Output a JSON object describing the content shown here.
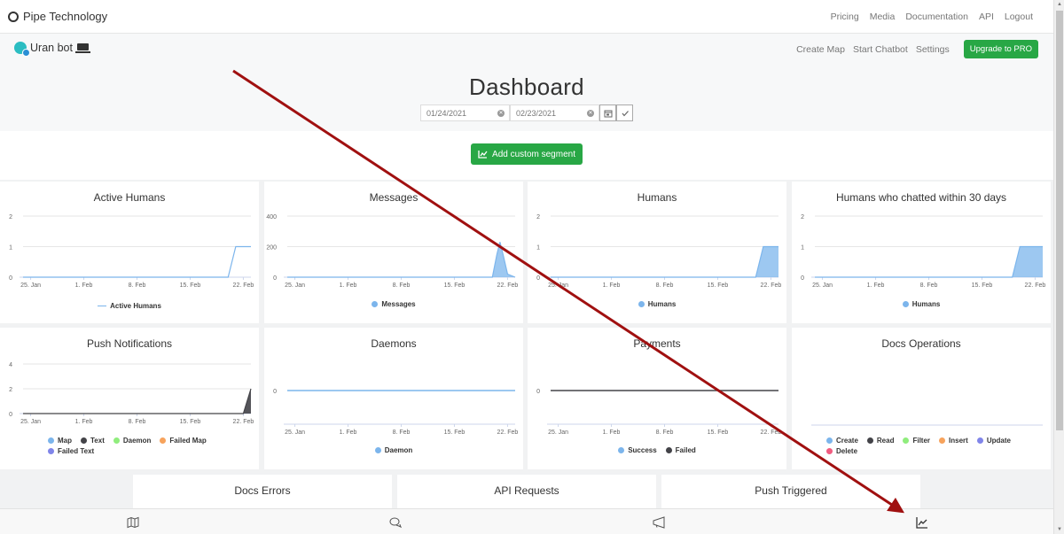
{
  "topnav": {
    "brand": "Pipe Technology",
    "links": [
      "Pricing",
      "Media",
      "Documentation",
      "API",
      "Logout"
    ]
  },
  "subheader": {
    "bot_name": "Uran bot",
    "links": [
      "Create Map",
      "Start Chatbot",
      "Settings"
    ],
    "upgrade_label": "Upgrade to PRO",
    "title": "Dashboard",
    "date_from": "01/24/2021",
    "date_to": "02/23/2021",
    "add_segment_label": "Add custom segment"
  },
  "colors": {
    "green": "#28a745",
    "series_blue": "#7cb5ec",
    "series_dark": "#434348",
    "series_green": "#90ed7d",
    "series_orange": "#f7a35c",
    "series_purple": "#8085e9",
    "series_pink": "#f15c80",
    "annotation_arrow": "#a01010"
  },
  "x_ticks": [
    "25. Jan",
    "1. Feb",
    "8. Feb",
    "15. Feb",
    "22. Feb"
  ],
  "chart_data": [
    {
      "id": "active-humans",
      "type": "line",
      "title": "Active Humans",
      "yticks": [
        "0",
        "1",
        "2"
      ],
      "ylim": [
        0,
        2
      ],
      "x": [
        "24. Jan",
        "20. Feb",
        "21. Feb",
        "23. Feb"
      ],
      "series": [
        {
          "name": "Active Humans",
          "color": "#7cb5ec",
          "style": "line",
          "points": [
            [
              0,
              0
            ],
            [
              27,
              0
            ],
            [
              28,
              1
            ],
            [
              30,
              1
            ]
          ]
        }
      ],
      "legend": [
        {
          "label": "Active Humans",
          "color": "#7cb5ec",
          "marker": "line"
        }
      ]
    },
    {
      "id": "messages",
      "type": "area",
      "title": "Messages",
      "yticks": [
        "0",
        "200",
        "400"
      ],
      "ylim": [
        0,
        400
      ],
      "series": [
        {
          "name": "Messages",
          "color": "#7cb5ec",
          "style": "area",
          "points": [
            [
              0,
              0
            ],
            [
              27,
              0
            ],
            [
              27.6,
              150
            ],
            [
              28,
              230
            ],
            [
              28.4,
              150
            ],
            [
              29,
              20
            ],
            [
              30,
              0
            ]
          ]
        }
      ],
      "legend": [
        {
          "label": "Messages",
          "color": "#7cb5ec",
          "marker": "dot"
        }
      ]
    },
    {
      "id": "humans",
      "type": "area",
      "title": "Humans",
      "yticks": [
        "0",
        "1",
        "2"
      ],
      "ylim": [
        0,
        2
      ],
      "series": [
        {
          "name": "Humans",
          "color": "#7cb5ec",
          "style": "area",
          "points": [
            [
              0,
              0
            ],
            [
              27,
              0
            ],
            [
              28,
              1
            ],
            [
              30,
              1
            ]
          ]
        }
      ],
      "legend": [
        {
          "label": "Humans",
          "color": "#7cb5ec",
          "marker": "dot"
        }
      ]
    },
    {
      "id": "humans-30d",
      "type": "area",
      "title": "Humans who chatted within 30 days",
      "yticks": [
        "0",
        "1",
        "2"
      ],
      "ylim": [
        0,
        2
      ],
      "series": [
        {
          "name": "Humans",
          "color": "#7cb5ec",
          "style": "area",
          "points": [
            [
              0,
              0
            ],
            [
              26,
              0
            ],
            [
              27,
              1
            ],
            [
              30,
              1
            ]
          ]
        }
      ],
      "legend": [
        {
          "label": "Humans",
          "color": "#7cb5ec",
          "marker": "dot"
        }
      ]
    },
    {
      "id": "push-notifications",
      "type": "area",
      "title": "Push Notifications",
      "yticks": [
        "0",
        "2",
        "4"
      ],
      "ylim": [
        0,
        4
      ],
      "series": [
        {
          "name": "Text",
          "color": "#434348",
          "style": "area",
          "points": [
            [
              0,
              0
            ],
            [
              29,
              0
            ],
            [
              30,
              2
            ]
          ]
        }
      ],
      "legend": [
        {
          "label": "Map",
          "color": "#7cb5ec",
          "marker": "dot"
        },
        {
          "label": "Text",
          "color": "#434348",
          "marker": "dot"
        },
        {
          "label": "Daemon",
          "color": "#90ed7d",
          "marker": "dot"
        },
        {
          "label": "Failed Map",
          "color": "#f7a35c",
          "marker": "dot"
        },
        {
          "label": "Failed Text",
          "color": "#8085e9",
          "marker": "dot"
        }
      ]
    },
    {
      "id": "daemons",
      "type": "line",
      "title": "Daemons",
      "yticks": [
        "0"
      ],
      "ylim": [
        -1,
        1
      ],
      "center_zero": true,
      "series": [
        {
          "name": "Daemon",
          "color": "#7cb5ec",
          "style": "line",
          "points": [
            [
              0,
              0
            ],
            [
              30,
              0
            ]
          ]
        }
      ],
      "legend": [
        {
          "label": "Daemon",
          "color": "#7cb5ec",
          "marker": "dot"
        }
      ]
    },
    {
      "id": "payments",
      "type": "line",
      "title": "Payments",
      "yticks": [
        "0"
      ],
      "ylim": [
        -1,
        1
      ],
      "center_zero": true,
      "series": [
        {
          "name": "Failed",
          "color": "#434348",
          "style": "line",
          "points": [
            [
              0,
              0
            ],
            [
              30,
              0
            ]
          ]
        }
      ],
      "legend": [
        {
          "label": "Success",
          "color": "#7cb5ec",
          "marker": "dot"
        },
        {
          "label": "Failed",
          "color": "#434348",
          "marker": "dot"
        }
      ]
    },
    {
      "id": "docs-operations",
      "type": "line",
      "title": "Docs Operations",
      "yticks": [],
      "ylim": [
        0,
        1
      ],
      "empty": true,
      "series": [],
      "legend": [
        {
          "label": "Create",
          "color": "#7cb5ec",
          "marker": "dot"
        },
        {
          "label": "Read",
          "color": "#434348",
          "marker": "dot"
        },
        {
          "label": "Filter",
          "color": "#90ed7d",
          "marker": "dot"
        },
        {
          "label": "Insert",
          "color": "#f7a35c",
          "marker": "dot"
        },
        {
          "label": "Update",
          "color": "#8085e9",
          "marker": "dot"
        },
        {
          "label": "Delete",
          "color": "#f15c80",
          "marker": "dot"
        }
      ]
    }
  ],
  "bottom_cards": [
    "Docs Errors",
    "API Requests",
    "Push Triggered"
  ],
  "bottom_nav": [
    "map-icon",
    "chat-icon",
    "megaphone-icon",
    "chart-line-icon"
  ]
}
